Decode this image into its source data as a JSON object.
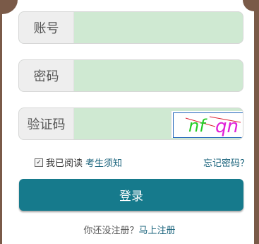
{
  "form": {
    "account_label": "账号",
    "account_value": "",
    "password_label": "密码",
    "password_value": "",
    "captcha_label": "验证码",
    "captcha_value": "",
    "captcha_image_text": "nf qn"
  },
  "agreement": {
    "checked": true,
    "prefix": "我已阅读",
    "notice_link": "考生须知"
  },
  "forgot_link": "忘记密码？",
  "login_button": "登录",
  "register": {
    "prompt": "你还没注册？",
    "link": "马上注册"
  },
  "colors": {
    "accent": "#167a8c",
    "link": "#17617a",
    "input_bg": "#cfe9d2"
  }
}
